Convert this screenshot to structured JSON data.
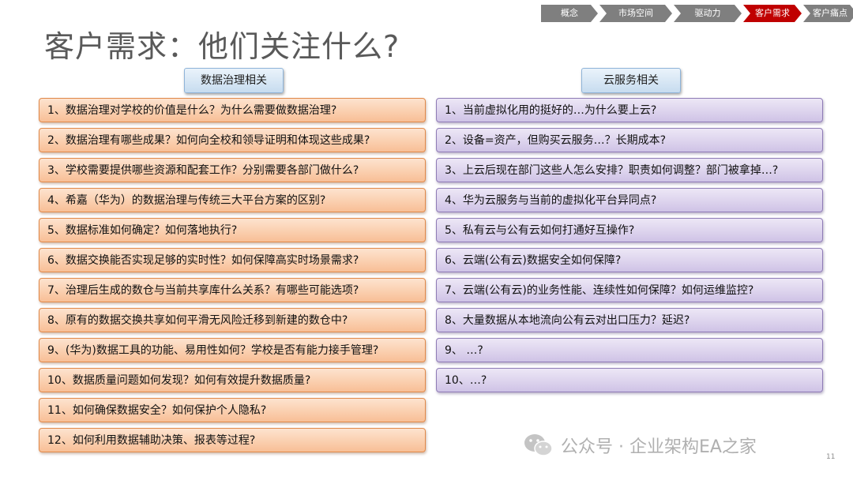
{
  "breadcrumb": [
    "概念",
    "市场空间",
    "驱动力",
    "客户需求",
    "客户痛点"
  ],
  "title": "客户需求：他们关注什么?",
  "left_section": {
    "header": "数据治理相关",
    "items": [
      "1、数据治理对学校的价值是什么？为什么需要做数据治理?",
      "2、数据治理有哪些成果？如何向全校和领导证明和体现这些成果?",
      "3、学校需要提供哪些资源和配套工作？分别需要各部门做什么?",
      "4、希嘉（华为）的数据治理与传统三大平台方案的区别?",
      "5、数据标准如何确定？如何落地执行?",
      "6、数据交换能否实现足够的实时性？如何保障高实时场景需求?",
      "7、治理后生成的数仓与当前共享库什么关系？有哪些可能选项?",
      "8、原有的数据交换共享如何平滑无风险迁移到新建的数仓中?",
      "9、(华为)数据工具的功能、易用性如何？学校是否有能力接手管理?",
      "10、数据质量问题如何发现？如何有效提升数据质量?",
      "11、如何确保数据安全？如何保护个人隐私?",
      "12、如何利用数据辅助决策、报表等过程?"
    ]
  },
  "right_section": {
    "header": "云服务相关",
    "items": [
      "1、当前虚拟化用的挺好的…为什么要上云?",
      "2、设备=资产，但购买云服务…？长期成本?",
      "3、上云后现在部门这些人怎么安排？职责如何调整？部门被拿掉…?",
      "4、华为云服务与当前的虚拟化平台异同点?",
      "5、私有云与公有云如何打通好互操作?",
      "6、云端(公有云)数据安全如何保障?",
      "7、云端(公有云)的业务性能、连续性如何保障？如何运维监控?",
      "8、大量数据从本地流向公有云对出口压力？延迟?",
      "9、 …?",
      "10、…?"
    ]
  },
  "watermark": "公众号 · 企业架构EA之家",
  "page_number": "11",
  "colors": {
    "active_crumb": "#c00000",
    "crumb": "#7f7f7f",
    "orange_box": "#f8bf96",
    "purple_box": "#cfc3e6",
    "header_box": "#c7dcef"
  }
}
